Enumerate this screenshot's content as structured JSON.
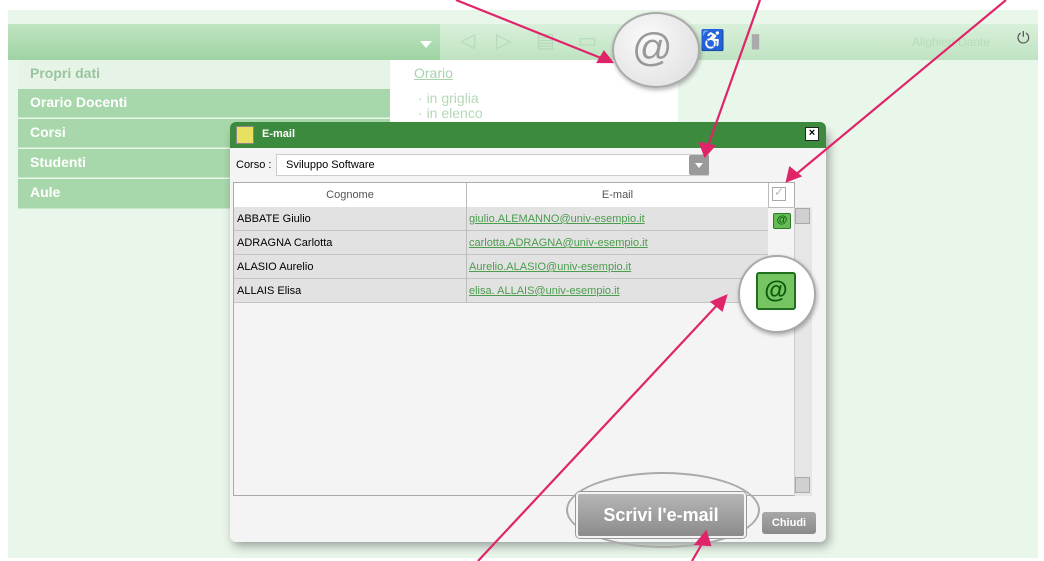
{
  "app": {
    "user_name": "Alighieri Dante",
    "sidebar": [
      {
        "label": "Propri dati"
      },
      {
        "label": "Orario Docenti"
      },
      {
        "label": "Corsi"
      },
      {
        "label": "Studenti"
      },
      {
        "label": "Aule"
      }
    ],
    "orario": {
      "link": "Orario",
      "items": [
        "in griglia",
        "in elenco"
      ]
    },
    "toolbar_icons": [
      "prev-icon",
      "next-icon",
      "print-icon",
      "save-icon",
      "email-icon",
      "accessibility-icon",
      "phone-icon"
    ]
  },
  "dialog": {
    "title": "E-mail",
    "corso_label": "Corso :",
    "corso_value": "Sviluppo Software",
    "columns": {
      "cognome": "Cognome",
      "email": "E-mail"
    },
    "rows": [
      {
        "name": "ABBATE Giulio",
        "email": "giulio.ALEMANNO@univ-esempio.it"
      },
      {
        "name": "ADRAGNA Carlotta",
        "email": "carlotta.ADRAGNA@univ-esempio.it"
      },
      {
        "name": "ALASIO Aurelio",
        "email": "Aurelio.ALASIO@univ-esempio.it"
      },
      {
        "name": "ALLAIS Elisa",
        "email": "elisa. ALLAIS@univ-esempio.it"
      }
    ],
    "email_icon_glyph": "@",
    "write_button": "Scrivi l'e-mail",
    "close_button": "Chiudi"
  },
  "colors": {
    "callout": "#e0246a",
    "dialog_title": "#3c8a3e",
    "menu_green": "#a8d7ab"
  }
}
